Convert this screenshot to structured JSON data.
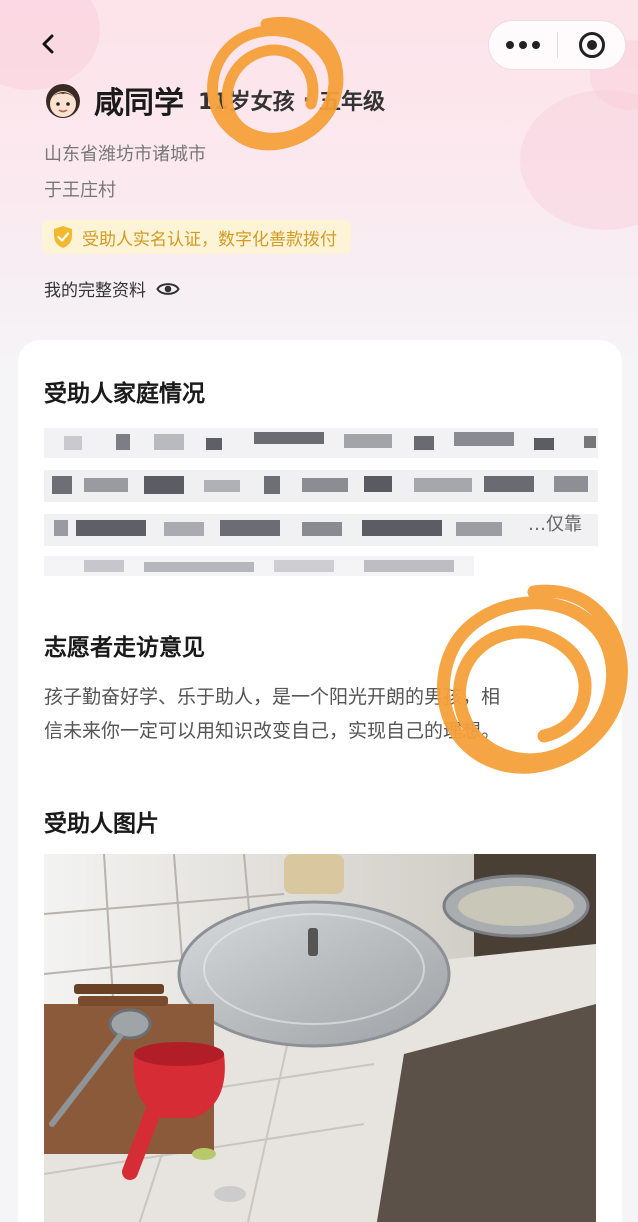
{
  "nav": {
    "back_icon": "chevron-left-icon",
    "more_icon": "more-dots-icon",
    "close_icon": "target-icon"
  },
  "beneficiary": {
    "name": "咸同学",
    "age_gender": "11岁女孩",
    "separator": "·",
    "grade": "五年级",
    "address_line1": "山东省潍坊市诸城市",
    "address_line2": "于王庄村",
    "verify_badge": "受助人实名认证，数字化善款拨付",
    "profile_link": "我的完整资料"
  },
  "sections": {
    "family_title": "受助人家庭情况",
    "family_visible_tail": "…仅靠",
    "volunteer_title": "志愿者走访意见",
    "volunteer_comment_line1": "孩子勤奋好学、乐于助人，是一个阳光开朗的男孩，相",
    "volunteer_comment_line2": "信未来你一定可以用知识改变自己，实现自己的理想。",
    "photos_title": "受助人图片"
  },
  "colors": {
    "accent_gold": "#d49a22",
    "badge_bg": "#fdf3d6",
    "annotation_orange": "#f5a03a"
  }
}
